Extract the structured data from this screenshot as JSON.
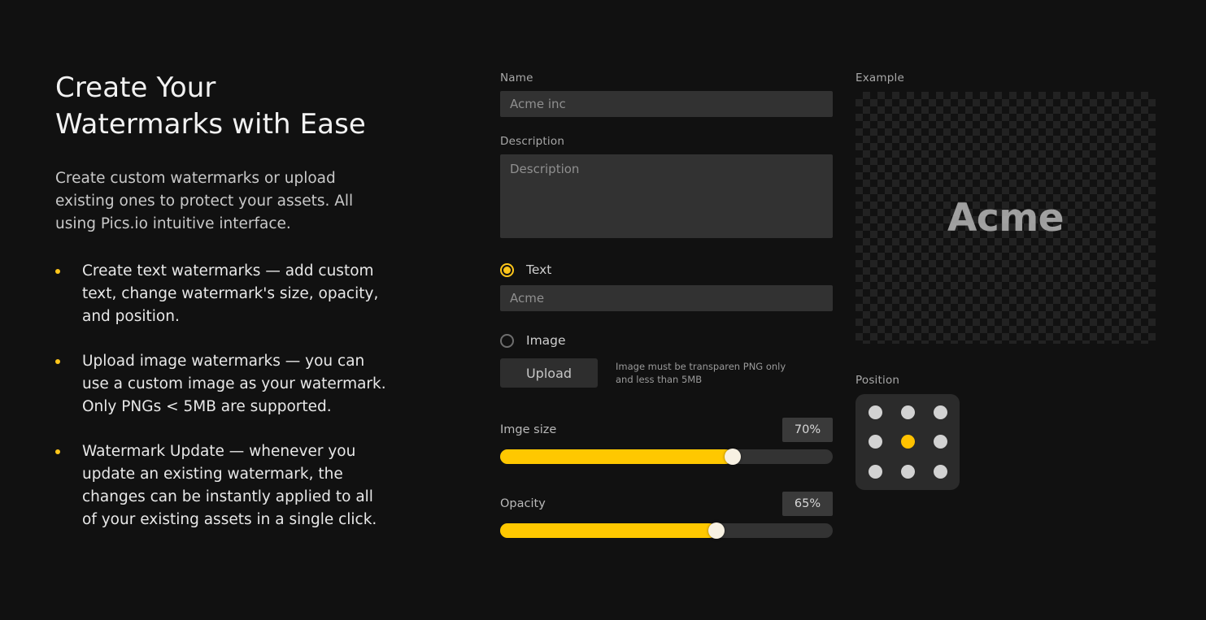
{
  "theme": {
    "background": "#111111",
    "accent": "#FFC61A",
    "slider_fill": "#FFC800",
    "field_bg": "#323232",
    "text_primary": "#f2f2f2",
    "text_secondary": "#c9c9c9",
    "label": "#a8a8a8"
  },
  "hero": {
    "headline": "Create Your\nWatermarks with Ease",
    "subhead": "Create custom watermarks or upload existing ones to protect your assets. All using Pics.io intuitive interface.",
    "bullets": [
      "Create text watermarks — add custom text, change watermark's size, opacity, and position.",
      "Upload image watermarks — you can use a custom image as your watermark. Only PNGs < 5MB are supported.",
      "Watermark Update — whenever you update an existing watermark, the changes can be instantly applied to all of your existing assets in a single click."
    ]
  },
  "form": {
    "name": {
      "label": "Name",
      "value": "Acme inc",
      "placeholder": "Acme inc"
    },
    "description": {
      "label": "Description",
      "value": "",
      "placeholder": "Description"
    },
    "type_options": [
      {
        "id": "text",
        "label": "Text",
        "selected": true
      },
      {
        "id": "image",
        "label": "Image",
        "selected": false
      }
    ],
    "watermark_text": {
      "value": "Acme",
      "placeholder": "Acme"
    },
    "upload": {
      "button_label": "Upload",
      "hint": "Image must be transparen PNG only and less than 5MB"
    },
    "sliders": [
      {
        "id": "image-size",
        "label": "Imge size",
        "value": "70%",
        "percent": 70
      },
      {
        "id": "opacity",
        "label": "Opacity",
        "value": "65%",
        "percent": 65
      }
    ]
  },
  "preview": {
    "label": "Example",
    "watermark_text": "Acme"
  },
  "position": {
    "label": "Position",
    "cells": [
      {
        "id": "top-left",
        "selected": false
      },
      {
        "id": "top-center",
        "selected": false
      },
      {
        "id": "top-right",
        "selected": false
      },
      {
        "id": "middle-left",
        "selected": false
      },
      {
        "id": "middle-center",
        "selected": true
      },
      {
        "id": "middle-right",
        "selected": false
      },
      {
        "id": "bottom-left",
        "selected": false
      },
      {
        "id": "bottom-center",
        "selected": false
      },
      {
        "id": "bottom-right",
        "selected": false
      }
    ]
  }
}
